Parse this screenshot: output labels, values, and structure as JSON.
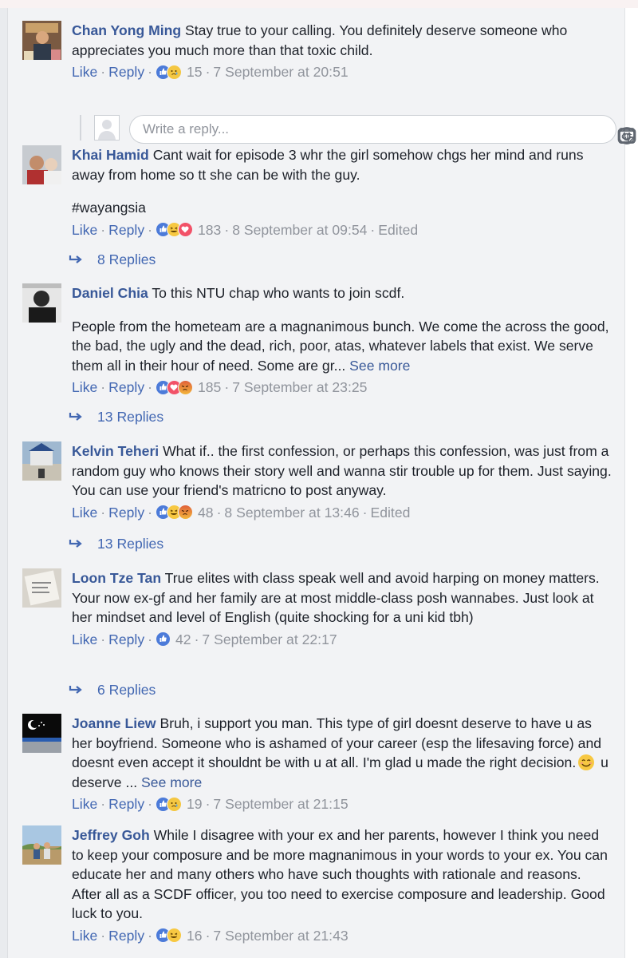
{
  "actions": {
    "like": "Like",
    "reply": "Reply",
    "edited": "Edited",
    "see_more": "See more"
  },
  "reply_box": {
    "placeholder": "Write a reply..."
  },
  "comments": [
    {
      "name": "Chan Yong Ming",
      "text": "Stay true to your calling. You definitely deserve someone who appreciates you much more than that toxic child.",
      "reactions": [
        "like",
        "sad"
      ],
      "count": "15",
      "time": "7 September at 20:51"
    },
    {
      "name": "Khai Hamid",
      "text": "Cant wait for episode 3 whr the girl somehow chgs her mind and runs away from home so tt she can be with the guy.",
      "text2": "#wayangsia",
      "reactions": [
        "like",
        "haha",
        "love"
      ],
      "count": "183",
      "time": "8 September at 09:54",
      "replies": "8 Replies"
    },
    {
      "name": "Daniel Chia",
      "text": "To this NTU chap who wants to join scdf.",
      "text2": "People from the hometeam are a magnanimous bunch. We come the across the good, the bad, the ugly and the dead, rich, poor, atas, whatever labels that exist. We serve them all in their hour of need. Some are gr...",
      "reactions": [
        "like",
        "love",
        "angry"
      ],
      "count": "185",
      "time": "7 September at 23:25",
      "replies": "13 Replies"
    },
    {
      "name": "Kelvin Teheri",
      "text": "What if.. the first confession, or perhaps this confession, was just from a random guy who knows their story well and wanna stir trouble up for them. Just saying. You can use your friend's matricno to post anyway.",
      "reactions": [
        "like",
        "haha",
        "angry"
      ],
      "count": "48",
      "time": "8 September at 13:46",
      "replies": "13 Replies"
    },
    {
      "name": "Loon Tze Tan",
      "text": "True elites with class speak well and avoid harping on money matters. Your now ex-gf and her family are at most middle-class posh wannabes. Just look at her mindset and level of English (quite shocking for a uni kid tbh)",
      "reactions": [
        "like"
      ],
      "count": "42",
      "time": "7 September at 22:17",
      "replies": "6 Replies"
    },
    {
      "name": "Joanne Liew",
      "text": "Bruh, i support you man. This type of girl doesnt deserve to have u as her boyfriend. Someone who is ashamed of your career (esp the lifesaving force) and doesnt even accept it shouldnt be with u at all. I'm glad u made the right decision.",
      "text_tail": "u deserve ...",
      "emoji": "smiling-face-emoji",
      "reactions": [
        "like",
        "sad"
      ],
      "count": "19",
      "time": "7 September at 21:15"
    },
    {
      "name": "Jeffrey Goh",
      "text": "While I disagree with your ex and her parents, however I think you need to keep your composure and be more magnanimous in your words to your ex. You can educate her and many others who have such thoughts with rationale and reasons. After all as a SCDF officer, you too need to exercise composure and leadership. Good luck to you.",
      "reactions": [
        "like",
        "haha"
      ],
      "count": "16",
      "time": "7 September at 21:43"
    }
  ],
  "colors": {
    "link": "#385898",
    "action": "#4267b2",
    "meta": "#90949c",
    "text": "#1d2129",
    "panel": "#f2f3f5"
  }
}
